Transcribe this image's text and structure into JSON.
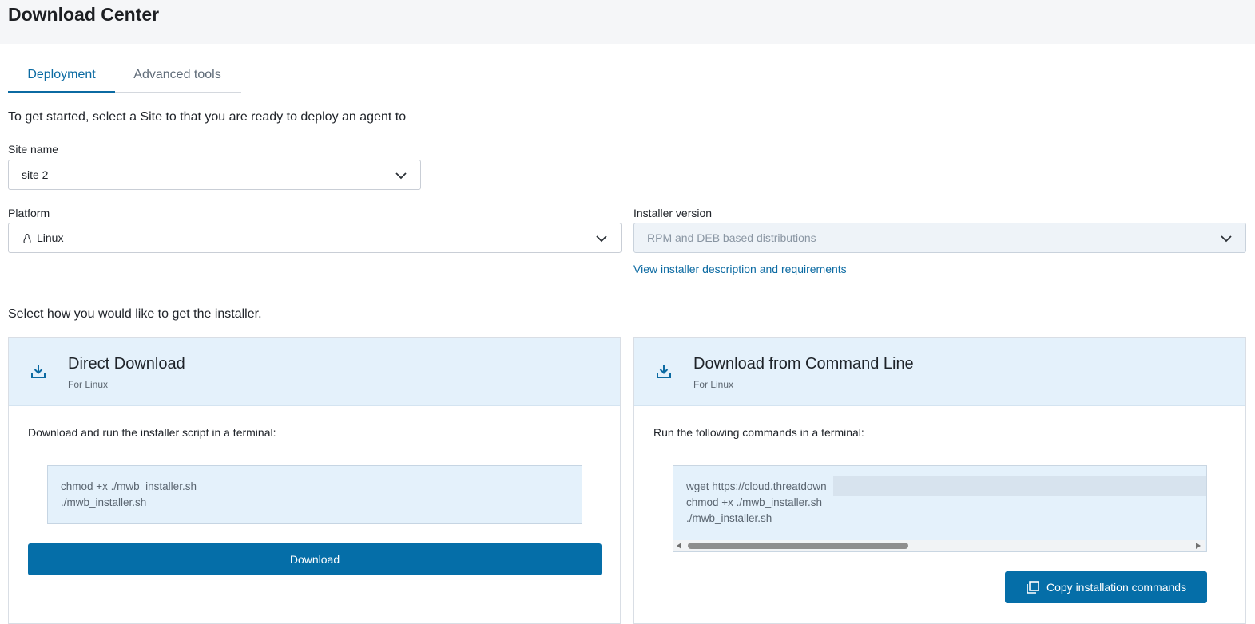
{
  "header": {
    "title": "Download Center"
  },
  "tabs": [
    {
      "label": "Deployment",
      "active": true
    },
    {
      "label": "Advanced tools",
      "active": false
    }
  ],
  "intro_text": "To get started, select a Site to that you are ready to deploy an agent to",
  "site": {
    "label": "Site name",
    "value": "site 2"
  },
  "platform": {
    "label": "Platform",
    "value": "Linux",
    "icon": "linux-icon"
  },
  "installer": {
    "label": "Installer version",
    "value": "RPM and DEB based distributions",
    "link": "View installer description and requirements"
  },
  "method_prompt": "Select how you would like to get the installer.",
  "direct": {
    "title": "Direct Download",
    "subtitle": "For Linux",
    "instructions": "Download and run the installer script in a terminal:",
    "code_lines": [
      "chmod +x ./mwb_installer.sh",
      "./mwb_installer.sh"
    ],
    "button": "Download"
  },
  "cmdline": {
    "title": "Download from Command Line",
    "subtitle": "For Linux",
    "instructions": "Run the following commands in a terminal:",
    "code_lines": [
      "wget https://cloud.threatdown",
      "chmod +x ./mwb_installer.sh",
      "./mwb_installer.sh"
    ],
    "button": "Copy installation commands"
  },
  "colors": {
    "accent": "#056ea8",
    "card_header_bg": "#e4f1fb",
    "code_bg": "#e4f1fb"
  }
}
